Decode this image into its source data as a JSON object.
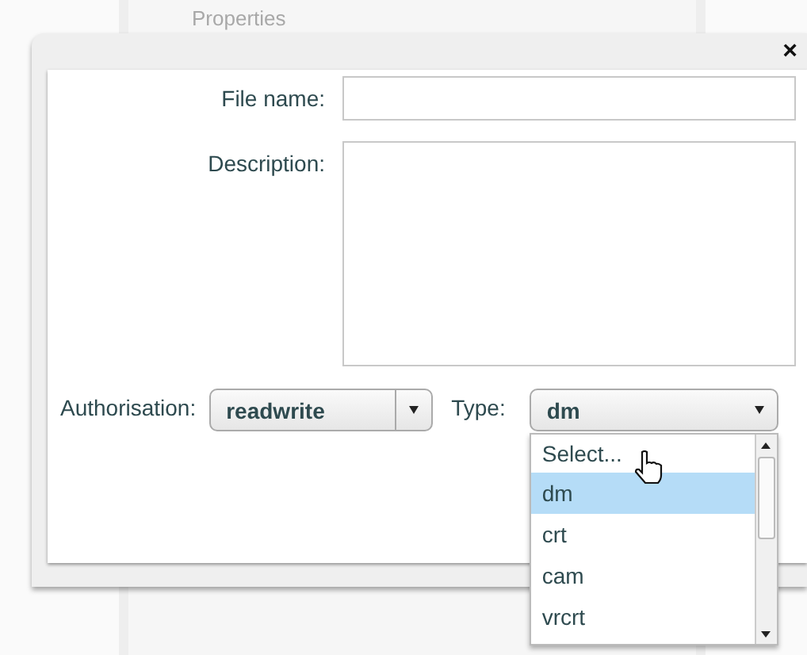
{
  "background": {
    "title": "Properties"
  },
  "dialog": {
    "close": "×",
    "file_name": {
      "label": "File name:"
    },
    "description": {
      "label": "Description:"
    },
    "authorisation": {
      "label": "Authorisation:",
      "value": "readwrite"
    },
    "type": {
      "label": "Type:",
      "value": "dm",
      "options": [
        {
          "label": "Select...",
          "selected": false
        },
        {
          "label": "dm",
          "selected": true
        },
        {
          "label": "crt",
          "selected": false
        },
        {
          "label": "cam",
          "selected": false
        },
        {
          "label": "vrcrt",
          "selected": false
        }
      ]
    }
  }
}
